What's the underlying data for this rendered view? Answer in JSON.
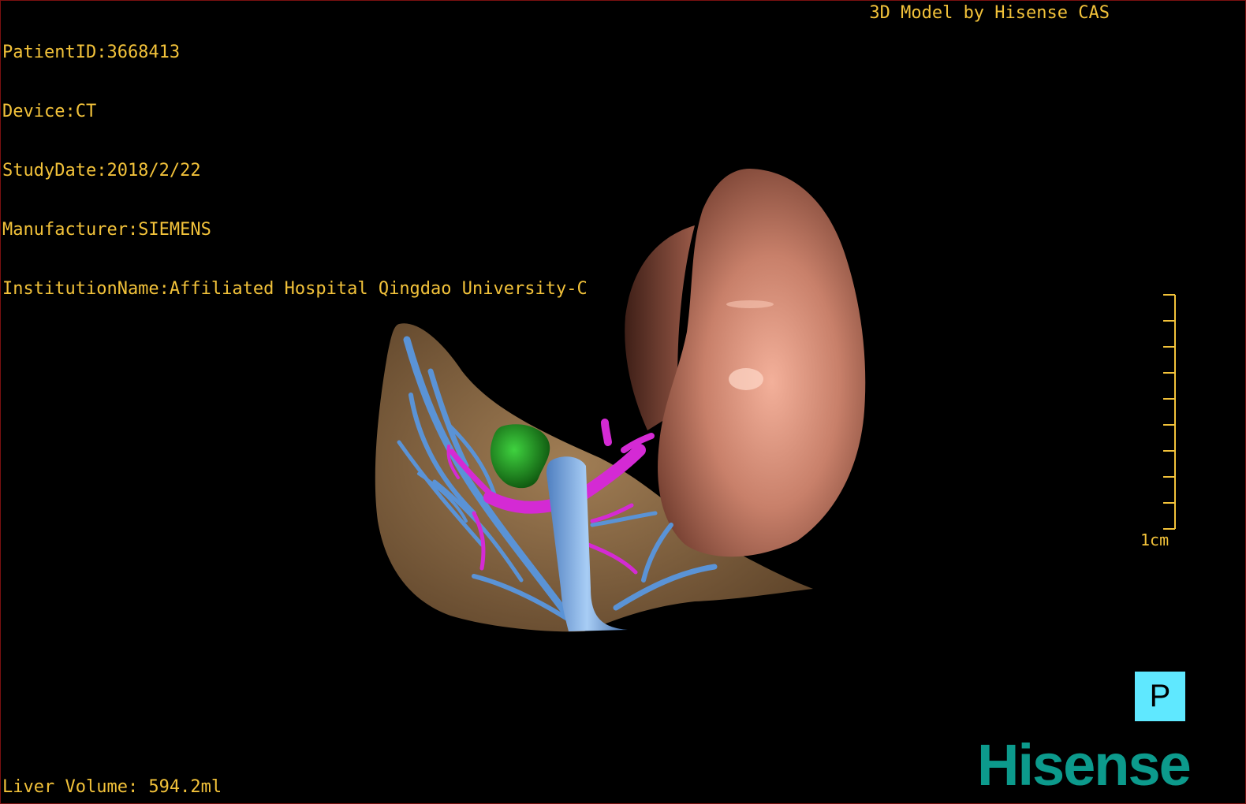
{
  "overlay": {
    "patient_id": "PatientID:3668413",
    "device": "Device:CT",
    "study_date": "StudyDate:2018/2/22",
    "manufacturer": "Manufacturer:SIEMENS",
    "institution": "InstitutionName:Affiliated Hospital Qingdao University-C",
    "credit": "3D Model by Hisense CAS",
    "liver_volume": "Liver Volume: 594.2ml"
  },
  "scale": {
    "label": "1cm"
  },
  "orientation": {
    "label": "P"
  },
  "brand": {
    "logo_text": "Hisense"
  },
  "colors": {
    "overlay_text": "#f2c23a",
    "liver": "#8c6a45",
    "kidney": "#c27a66",
    "portal_vein": "#d42ad4",
    "hepatic_vein": "#5a93d6",
    "tumor": "#1e8a1e",
    "orientation_box": "#5fe8ff",
    "logo": "#0c9a8c"
  }
}
